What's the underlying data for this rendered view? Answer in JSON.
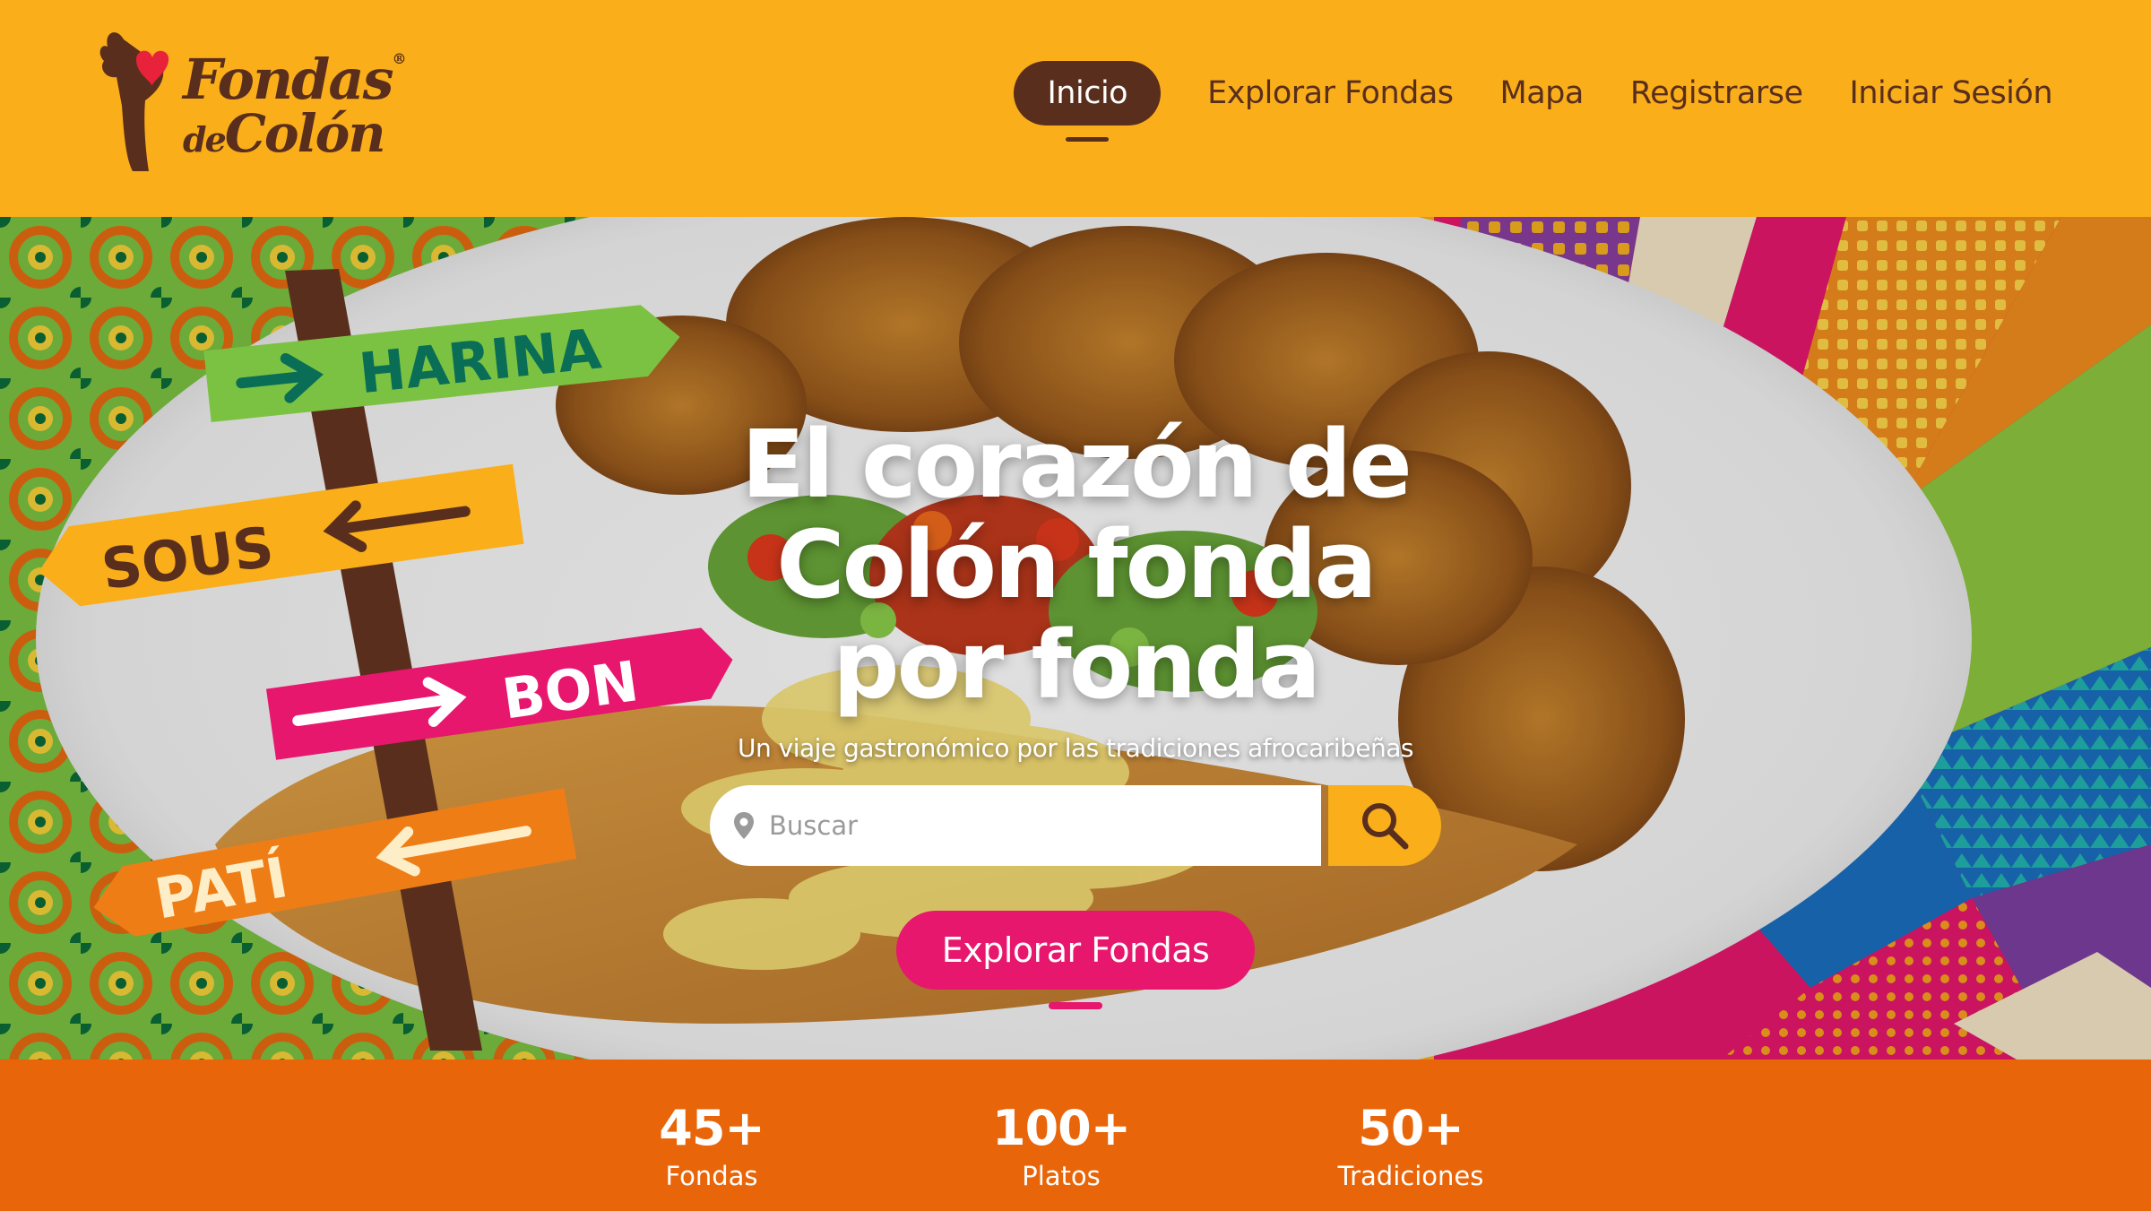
{
  "brand": {
    "name_line1": "Fondas",
    "name_de": "de",
    "name_line2": "Colón",
    "registered": "®"
  },
  "nav": {
    "items": [
      {
        "label": "Inicio",
        "active": true
      },
      {
        "label": "Explorar Fondas",
        "active": false
      },
      {
        "label": "Mapa",
        "active": false
      },
      {
        "label": "Registrarse",
        "active": false
      },
      {
        "label": "Iniciar Sesión",
        "active": false
      }
    ]
  },
  "hero": {
    "title_line1": "El corazón de",
    "title_line2": "Colón fonda",
    "title_line3": "por fonda",
    "subtitle": "Un viaje gastronómico por las tradiciones afrocaribeñas",
    "signs": [
      "HARINA",
      "SOUS",
      "BON",
      "PATÍ"
    ],
    "search": {
      "placeholder": "Buscar",
      "value": ""
    },
    "cta_label": "Explorar Fondas"
  },
  "stats": [
    {
      "value": "45+",
      "label": "Fondas"
    },
    {
      "value": "100+",
      "label": "Platos"
    },
    {
      "value": "50+",
      "label": "Tradiciones"
    }
  ],
  "colors": {
    "header_bg": "#f9ae1a",
    "brown": "#5a2e1c",
    "pink": "#e6176d",
    "orange_band": "#e8650a",
    "green": "#7ac143",
    "teal": "#0a6e56"
  },
  "icons": {
    "search": "search-icon",
    "pin": "map-pin-icon",
    "logo": "heart-hand-logo-icon"
  }
}
